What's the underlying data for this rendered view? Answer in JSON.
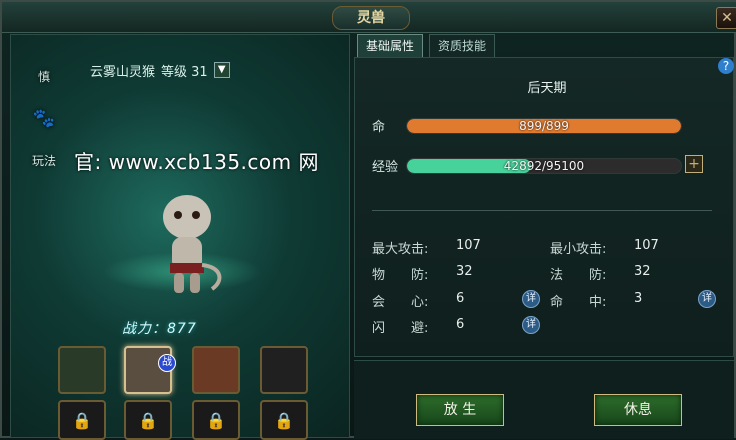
{
  "window": {
    "title": "灵兽",
    "close": "✕"
  },
  "left": {
    "side_tabs": [
      "慎",
      "🐾",
      "玩法"
    ],
    "pet_name": "云雾山灵猴",
    "level_label": "等级 31",
    "dropdown_icon": "▼",
    "watermark": "官: www.xcb135.com 网",
    "combat_power": "战力：877",
    "slots": [
      {
        "name": "tree-pet",
        "selected": false
      },
      {
        "name": "monkey-pet",
        "selected": true,
        "badge": "战"
      },
      {
        "name": "red-lion-pet",
        "selected": false
      },
      {
        "name": "empty-slot",
        "selected": false
      }
    ]
  },
  "right": {
    "tabs": [
      {
        "label": "基础属性",
        "active": true
      },
      {
        "label": "资质技能",
        "active": false
      }
    ],
    "help_icon": "?",
    "stage_text": "后天期",
    "life": {
      "label": "命",
      "text": "899/899",
      "value": 1.0,
      "color": "#e07a2e"
    },
    "exp": {
      "label": "经验",
      "text": "42892/95100",
      "value": 0.451,
      "color": "#47d19b"
    },
    "plus": "+",
    "stats": {
      "max_attack": {
        "label": "最大攻击:",
        "value": "107"
      },
      "min_attack": {
        "label": "最小攻击:",
        "value": "107"
      },
      "phys_def": {
        "label": "物　　防:",
        "value": "32"
      },
      "magic_def": {
        "label": "法　　防:",
        "value": "32"
      },
      "crit": {
        "label": "会　　心:",
        "value": "6"
      },
      "hit": {
        "label": "命　　中:",
        "value": "3"
      },
      "dodge": {
        "label": "闪　　避:",
        "value": "6"
      }
    },
    "detail_icon": "详"
  },
  "buttons": {
    "release": "放 生",
    "rest": "休息"
  }
}
